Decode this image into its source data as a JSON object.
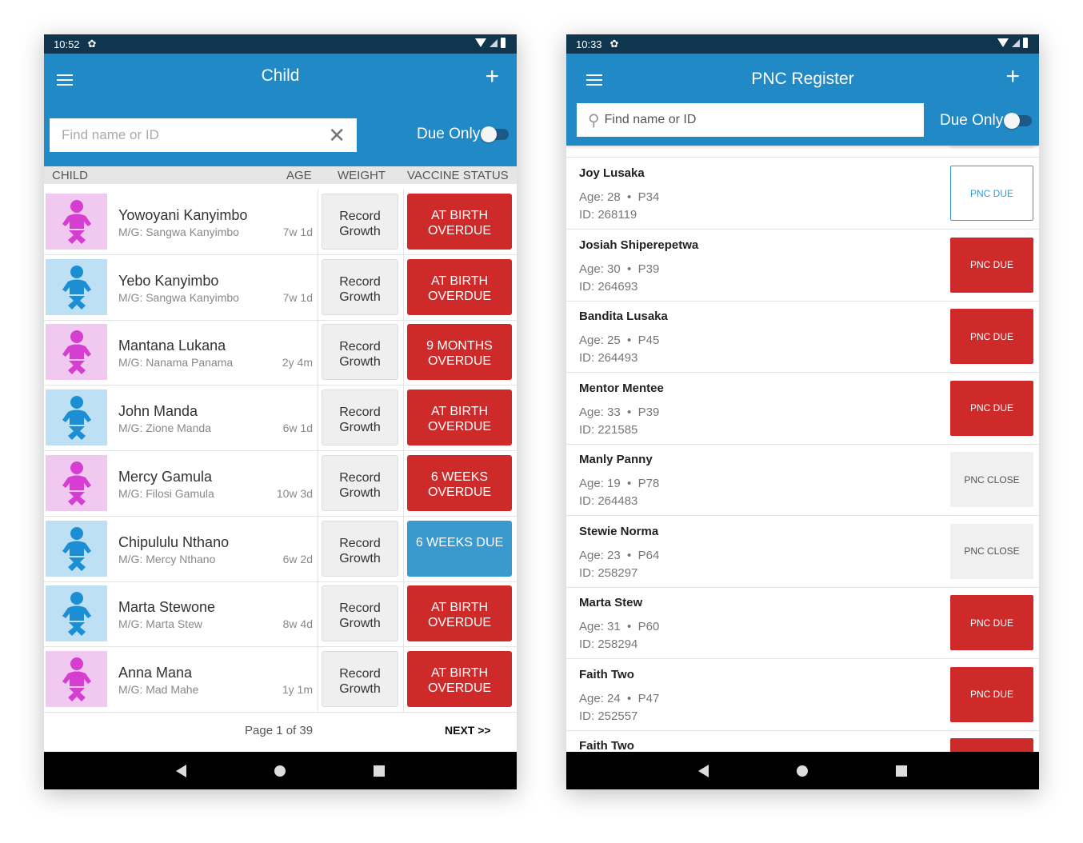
{
  "colors": {
    "header": "#2189c6",
    "overdue": "#cf2a2a",
    "due": "#3a9ad0",
    "girl_bg": "#f1c8ef",
    "girl_icon": "#d63dd1",
    "boy_bg": "#bde0f4",
    "boy_icon": "#1c8fd4"
  },
  "child": {
    "status": {
      "time": "10:52",
      "gear_icon": "gear-icon"
    },
    "title": "Child",
    "search_placeholder": "Find name or ID",
    "due_only": "Due Only",
    "columns": {
      "child": "CHILD",
      "age": "AGE",
      "weight": "WEIGHT",
      "vaccine": "VACCINE STATUS"
    },
    "rows": [
      {
        "name": "Yowoyani Kanyimbo",
        "mg": "M/G: Sangwa Kanyimbo",
        "age": "7w 1d",
        "gender": "girl",
        "weight": "Record Growth",
        "status": "AT BIRTH OVERDUE",
        "state": "overdue"
      },
      {
        "name": "Yebo Kanyimbo",
        "mg": "M/G: Sangwa Kanyimbo",
        "age": "7w 1d",
        "gender": "boy",
        "weight": "Record Growth",
        "status": "AT BIRTH OVERDUE",
        "state": "overdue"
      },
      {
        "name": "Mantana Lukana",
        "mg": "M/G: Nanama Panama",
        "age": "2y 4m",
        "gender": "girl",
        "weight": "Record Growth",
        "status": "9 MONTHS OVERDUE",
        "state": "overdue"
      },
      {
        "name": "John Manda",
        "mg": "M/G: Zione Manda",
        "age": "6w 1d",
        "gender": "boy",
        "weight": "Record Growth",
        "status": "AT BIRTH OVERDUE",
        "state": "overdue"
      },
      {
        "name": "Mercy Gamula",
        "mg": "M/G: Filosi Gamula",
        "age": "10w 3d",
        "gender": "girl",
        "weight": "Record Growth",
        "status": "6 WEEKS OVERDUE",
        "state": "overdue"
      },
      {
        "name": "Chipululu Nthano",
        "mg": "M/G: Mercy Nthano",
        "age": "6w 2d",
        "gender": "boy",
        "weight": "Record Growth",
        "status": "6 WEEKS DUE",
        "state": "due"
      },
      {
        "name": "Marta Stewone",
        "mg": "M/G: Marta Stew",
        "age": "8w 4d",
        "gender": "boy",
        "weight": "Record Growth",
        "status": "AT BIRTH OVERDUE",
        "state": "overdue"
      },
      {
        "name": "Anna Mana",
        "mg": "M/G: Mad Mahe",
        "age": "1y 1m",
        "gender": "girl",
        "weight": "Record Growth",
        "status": "AT BIRTH OVERDUE",
        "state": "overdue"
      }
    ],
    "pagination": {
      "page": "Page 1 of 39",
      "next": "NEXT >>"
    }
  },
  "pnc": {
    "status": {
      "time": "10:33",
      "gear_icon": "gear-icon"
    },
    "title": "PNC Register",
    "search_placeholder": "Find name or ID",
    "due_only": "Due Only",
    "rows": [
      {
        "name": "Joy Lusaka",
        "age": "Age: 28",
        "parity": "P34",
        "id": "ID: 268119",
        "status": "PNC DUE",
        "state": "due-outline"
      },
      {
        "name": "Josiah Shiperepetwa",
        "age": "Age: 30",
        "parity": "P39",
        "id": "ID: 264693",
        "status": "PNC DUE",
        "state": "overdue"
      },
      {
        "name": "Bandita Lusaka",
        "age": "Age: 25",
        "parity": "P45",
        "id": "ID: 264493",
        "status": "PNC DUE",
        "state": "overdue"
      },
      {
        "name": "Mentor Mentee",
        "age": "Age: 33",
        "parity": "P39",
        "id": "ID: 221585",
        "status": "PNC DUE",
        "state": "overdue"
      },
      {
        "name": "Manly Panny",
        "age": "Age: 19",
        "parity": "P78",
        "id": "ID: 264483",
        "status": "PNC CLOSE",
        "state": "close"
      },
      {
        "name": "Stewie Norma",
        "age": "Age: 23",
        "parity": "P64",
        "id": "ID: 258297",
        "status": "PNC CLOSE",
        "state": "close"
      },
      {
        "name": "Marta Stew",
        "age": "Age: 31",
        "parity": "P60",
        "id": "ID: 258294",
        "status": "PNC DUE",
        "state": "overdue"
      },
      {
        "name": "Faith Two",
        "age": "Age: 24",
        "parity": "P47",
        "id": "ID: 252557",
        "status": "PNC DUE",
        "state": "overdue"
      },
      {
        "name": "Faith Two",
        "age": "",
        "parity": "",
        "id": "",
        "status": "",
        "state": "overdue"
      }
    ]
  }
}
